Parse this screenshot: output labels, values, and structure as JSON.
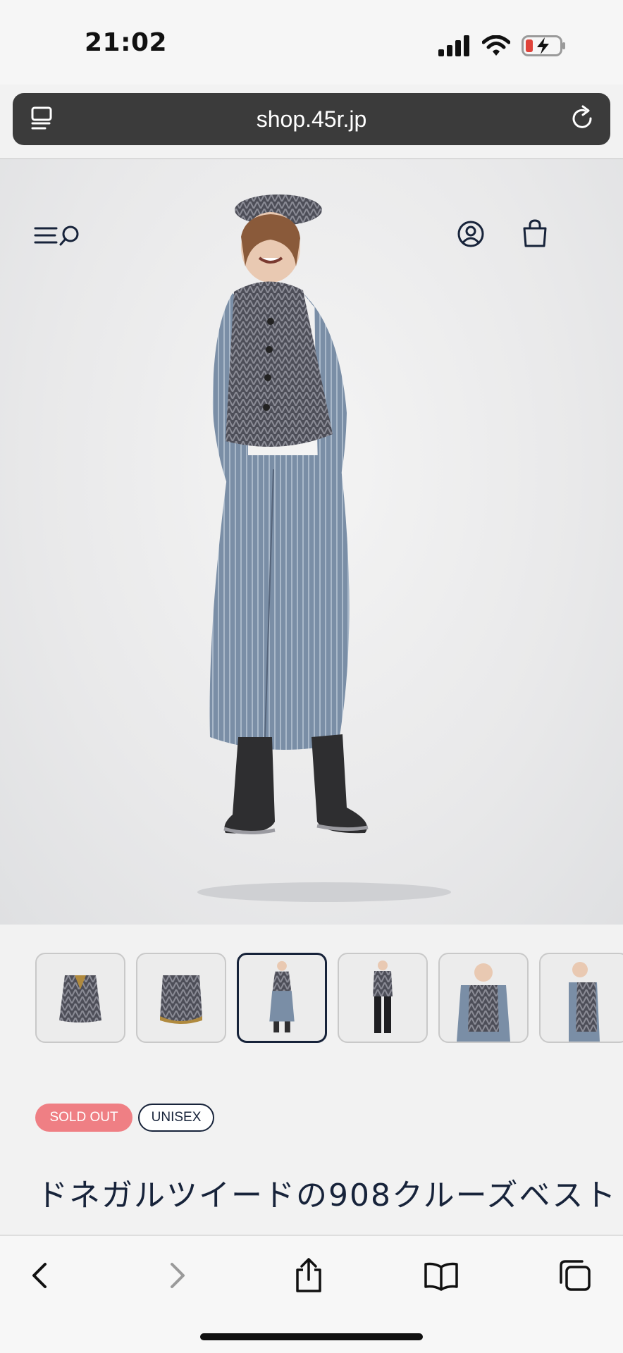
{
  "status_bar": {
    "time": "21:02",
    "icons": [
      "signal-icon",
      "wifi-icon",
      "battery-charging-icon"
    ]
  },
  "browser": {
    "url": "shop.45r.jp",
    "left_icon": "tab-overview-icon",
    "right_icon": "reload-icon"
  },
  "site_header": {
    "icons": [
      "menu-icon",
      "search-icon",
      "account-icon",
      "bag-icon"
    ]
  },
  "gallery": {
    "thumbnail_count": 6,
    "active_index": 2
  },
  "product": {
    "tags": {
      "sold_out": "SOLD OUT",
      "unisex": "UNISEX"
    },
    "title": "ドネガルツイードの908クルーズベスト"
  },
  "toolbar": {
    "icons": [
      "back-icon",
      "forward-icon",
      "share-icon",
      "bookmarks-icon",
      "tabs-icon"
    ]
  },
  "colors": {
    "url_bar_bg": "#3b3b3b",
    "text_navy": "#17233a",
    "sold_out_bg": "#ef7f84",
    "battery_low": "#e0433a"
  }
}
